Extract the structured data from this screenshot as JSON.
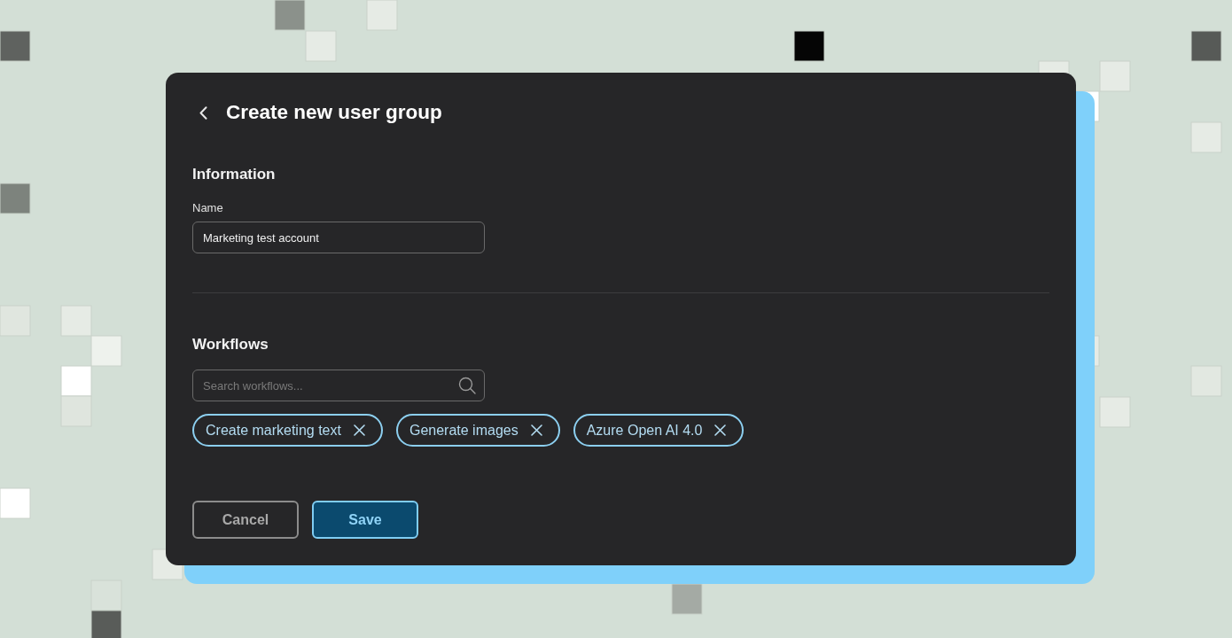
{
  "header": {
    "title": "Create new user group"
  },
  "information": {
    "heading": "Information",
    "name_field": {
      "label": "Name",
      "value": "Marketing test account"
    }
  },
  "workflows": {
    "heading": "Workflows",
    "search": {
      "placeholder": "Search workflows..."
    },
    "chips": [
      {
        "label": "Create marketing text"
      },
      {
        "label": "Generate images"
      },
      {
        "label": "Azure Open AI 4.0"
      }
    ]
  },
  "buttons": [
    {
      "label": "Cancel",
      "kind": "secondary"
    },
    {
      "label": "Save",
      "kind": "primary"
    }
  ]
}
